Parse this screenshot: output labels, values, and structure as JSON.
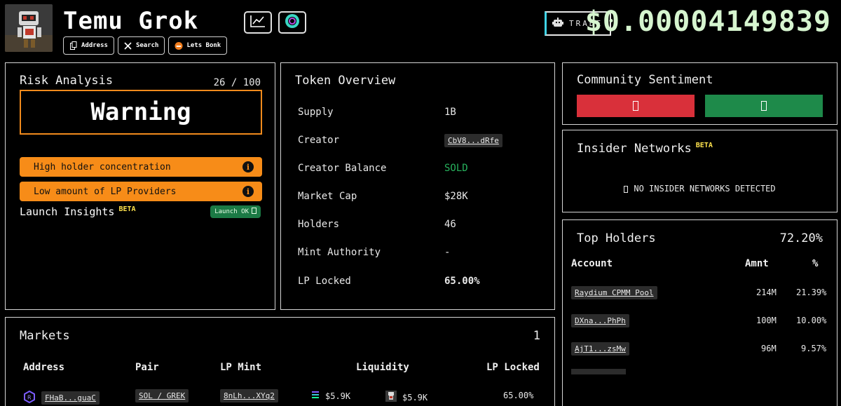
{
  "token": {
    "name": "Temu Grok",
    "price": "$0.00004149839"
  },
  "header": {
    "chips": [
      {
        "label": "Address",
        "icon": "copy-icon"
      },
      {
        "label": "Search",
        "icon": "x-logo-icon"
      },
      {
        "label": "Lets Bonk",
        "icon": "bonk-icon"
      }
    ],
    "trade_label": "TRADE"
  },
  "risk": {
    "title": "Risk Analysis",
    "score": "26 / 100",
    "level": "Warning",
    "items": [
      {
        "text": "High holder concentration"
      },
      {
        "text": "Low amount of LP Providers"
      }
    ],
    "launch_label": "Launch Insights",
    "beta": "BETA",
    "launch_badge": "Launch OK"
  },
  "overview": {
    "title": "Token Overview",
    "rows": [
      {
        "label": "Supply",
        "value": "1B"
      },
      {
        "label": "Creator",
        "value": "CbV8...dRfe"
      },
      {
        "label": "Creator Balance",
        "value": "SOLD"
      },
      {
        "label": "Market Cap",
        "value": "$28K"
      },
      {
        "label": "Holders",
        "value": "46"
      },
      {
        "label": "Mint Authority",
        "value": "-"
      },
      {
        "label": "LP Locked",
        "value": "65.00%"
      }
    ]
  },
  "sentiment": {
    "title": "Community Sentiment"
  },
  "insider": {
    "title": "Insider Networks",
    "beta": "BETA",
    "message": "NO INSIDER NETWORKS DETECTED"
  },
  "holders": {
    "title": "Top Holders",
    "total": "72.20%",
    "columns": [
      "Account",
      "Amnt",
      "%"
    ],
    "rows": [
      {
        "account": "Raydium CPMM Pool",
        "amount": "214M",
        "pct": "21.39%"
      },
      {
        "account": "DXna...PhPh",
        "amount": "100M",
        "pct": "10.00%"
      },
      {
        "account": "AjT1...zsMw",
        "amount": "96M",
        "pct": "9.57%"
      }
    ]
  },
  "markets": {
    "title": "Markets",
    "count": "1",
    "columns": [
      "Address",
      "Pair",
      "LP Mint",
      "Liquidity",
      "LP Locked"
    ],
    "rows": [
      {
        "address": "FHaB...guaC",
        "pair": "SOL / GREK",
        "lp_mint": "8nLh...XYq2",
        "liq_a": "$5.9K",
        "liq_b": "$5.9K",
        "lp_locked": "65.00%"
      }
    ]
  }
}
